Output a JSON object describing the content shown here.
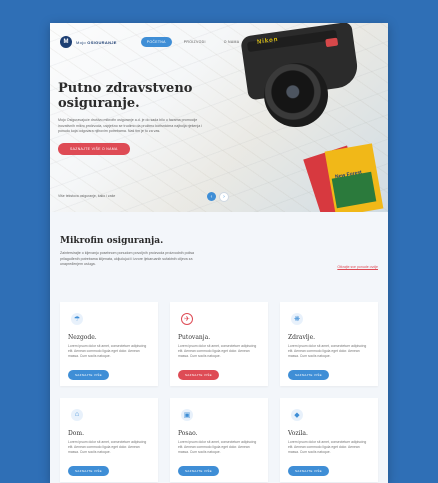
{
  "nav": {
    "logo_mark": "M",
    "logo_light": "Mojo",
    "logo_bold": "OSIGURANJE",
    "items": [
      {
        "label": "POČETNA",
        "active": true
      },
      {
        "label": "PROIZVODI",
        "active": false
      },
      {
        "label": "O NAMA",
        "active": false
      },
      {
        "label": "KONTAKT",
        "active": false
      }
    ]
  },
  "hero": {
    "title_line1": "Putno zdravstveno",
    "title_line2": "osiguranje.",
    "text": "Mojo Osiguravajuće društvo mikrofin osiguranje a.d. je do sada bilo u fazama promocije inovativnih mikro proizvoda, uspješno se trudimo da pružimo korisnicima najbolja rješenja i ponudu koja odgovara njihovim potrebama. Naš tim je tu za vas.",
    "button": "SAZNAJTE VIŠE O NAMA",
    "caption": "Više tekstova osiguranje, kako i zaše",
    "prev_arrow": "‹",
    "next_arrow": "›",
    "camera_text": "Nikon",
    "book_text": "New Forest"
  },
  "section": {
    "title": "Mikrofin osiguranja.",
    "text": "Zaintersirajte o kljevanju posebnom ponudom povoljnih proizvoda proizvodnih polisa prilagođenih potrebama klijenata, uključujući i izvore ljekaruanih sufaktnih ciljeva za unapređenjem usluga.",
    "link": "Otkrajte sve ponude ovdje"
  },
  "cards": [
    {
      "icon": "umbrella-icon",
      "glyph": "☂",
      "title": "Nezgode.",
      "text": "Lorem ipsum dolor sit amet, consectetuer adipiscing elit. Aenean commodo ligula eget dolor. Aenean massa. Cum sociis natoque.",
      "button": "SAZNAJTE VIŠE",
      "highlight": false
    },
    {
      "icon": "plane-icon",
      "glyph": "✈",
      "title": "Putovanja.",
      "text": "Lorem ipsum dolor sit amet, consectetuer adipiscing elit. Aenean commodo ligula eget dolor. Aenean massa. Cum sociis natoque.",
      "button": "SAZNAJTE VIŠE",
      "highlight": true
    },
    {
      "icon": "family-icon",
      "glyph": "❋",
      "title": "Zdravlje.",
      "text": "Lorem ipsum dolor sit amet, consectetuer adipiscing elit. Aenean commodo ligula eget dolor. Aenean massa. Cum sociis natoque.",
      "button": "SAZNAJTE VIŠE",
      "highlight": false
    },
    {
      "icon": "house-icon",
      "glyph": "⌂",
      "title": "Dom.",
      "text": "Lorem ipsum dolor sit amet, consectetuer adipiscing elit. Aenean commodo ligula eget dolor. Aenean massa. Cum sociis natoque.",
      "button": "SAZNAJTE VIŠE",
      "highlight": false
    },
    {
      "icon": "briefcase-icon",
      "glyph": "▣",
      "title": "Posao.",
      "text": "Lorem ipsum dolor sit amet, consectetuer adipiscing elit. Aenean commodo ligula eget dolor. Aenean massa. Cum sociis natoque.",
      "button": "SAZNAJTE VIŠE",
      "highlight": false
    },
    {
      "icon": "car-icon",
      "glyph": "◆",
      "title": "Vozila.",
      "text": "Lorem ipsum dolor sit amet, consectetuer adipiscing elit. Aenean commodo ligula eget dolor. Aenean massa. Cum sociis natoque.",
      "button": "SAZNAJTE VIŠE",
      "highlight": false
    }
  ],
  "colors": {
    "accent": "#3f8ed6",
    "highlight": "#de4b55",
    "background": "#2f6fb6"
  }
}
